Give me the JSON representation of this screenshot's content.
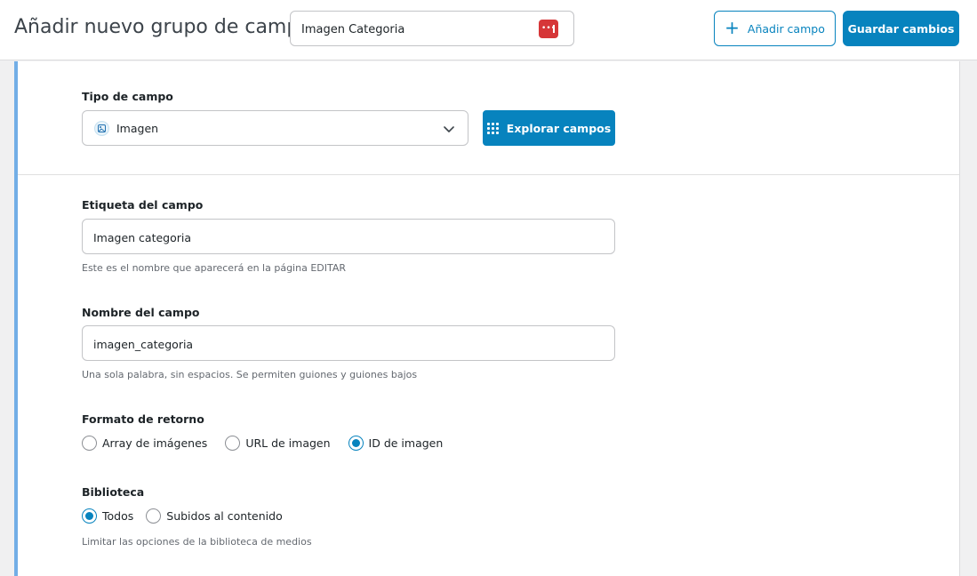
{
  "header": {
    "title": "Añadir nuevo grupo de campos",
    "group_title_value": "Imagen Categoria",
    "add_field_label": "Añadir campo",
    "save_label": "Guardar cambios"
  },
  "field_type": {
    "label": "Tipo de campo",
    "selected": "Imagen",
    "explore_label": "Explorar campos"
  },
  "field_label": {
    "label": "Etiqueta del campo",
    "value": "Imagen categoria",
    "hint": "Este es el nombre que aparecerá en la página EDITAR"
  },
  "field_name": {
    "label": "Nombre del campo",
    "value": "imagen_categoria",
    "hint": "Una sola palabra, sin espacios. Se permiten guiones y guiones bajos"
  },
  "return_format": {
    "label": "Formato de retorno",
    "options": [
      "Array de imágenes",
      "URL de imagen",
      "ID de imagen"
    ],
    "selected": "ID de imagen"
  },
  "library": {
    "label": "Biblioteca",
    "options": [
      "Todos",
      "Subidos al contenido"
    ],
    "selected": "Todos",
    "hint": "Limitar las opciones de la biblioteca de medios"
  },
  "colors": {
    "accent": "#0783be",
    "panel_border": "#72aee6",
    "password_badge": "#d63638"
  },
  "icons": {
    "add": "plus-icon",
    "password_manager": "password-manager-icon",
    "field_type": "image-icon",
    "dropdown": "chevron-down-icon",
    "explore": "grid-dots-icon"
  }
}
